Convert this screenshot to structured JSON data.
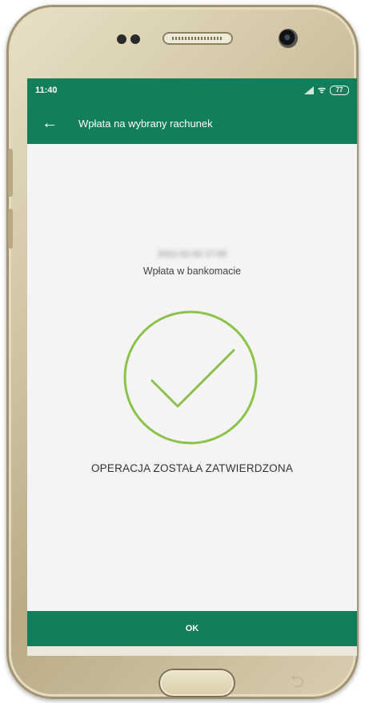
{
  "status_bar": {
    "time": "11:40",
    "battery": "77"
  },
  "app_bar": {
    "back_icon": "arrow-left-icon",
    "title": "Wpłata na wybrany rachunek"
  },
  "content": {
    "datetime": "2021-02-02 17:05",
    "subtitle": "Wpłata w bankomacie",
    "status_icon": "checkmark-circle-icon",
    "result_text": "OPERACJA ZOSTAŁA ZATWIERDZONA"
  },
  "footer": {
    "ok_label": "OK"
  },
  "colors": {
    "brand_green": "#137e5a",
    "check_green": "#8bc34a",
    "phone_gold": "#cfc3a1"
  }
}
